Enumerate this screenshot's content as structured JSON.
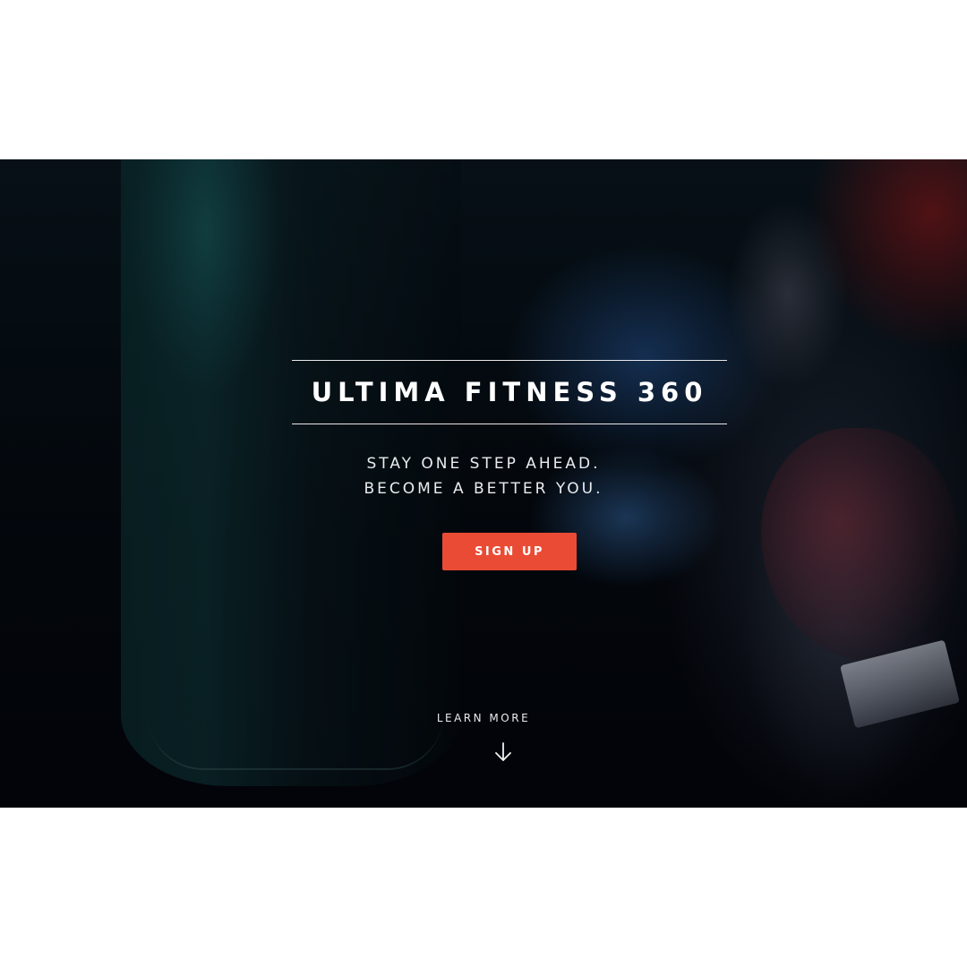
{
  "hero": {
    "title": "ULTIMA FITNESS 360",
    "tagline_line1": "STAY ONE STEP AHEAD.",
    "tagline_line2": "BECOME A BETTER YOU.",
    "signup_label": "SIGN UP",
    "learn_more_label": "LEARN MORE",
    "learn_more_icon": "arrow-down-icon",
    "background_image": "boxer-punching-bag-photo"
  },
  "colors": {
    "accent": "#ea4b35",
    "hero_background": "#03070c",
    "text": "#ffffff",
    "page_background": "#ffffff"
  }
}
